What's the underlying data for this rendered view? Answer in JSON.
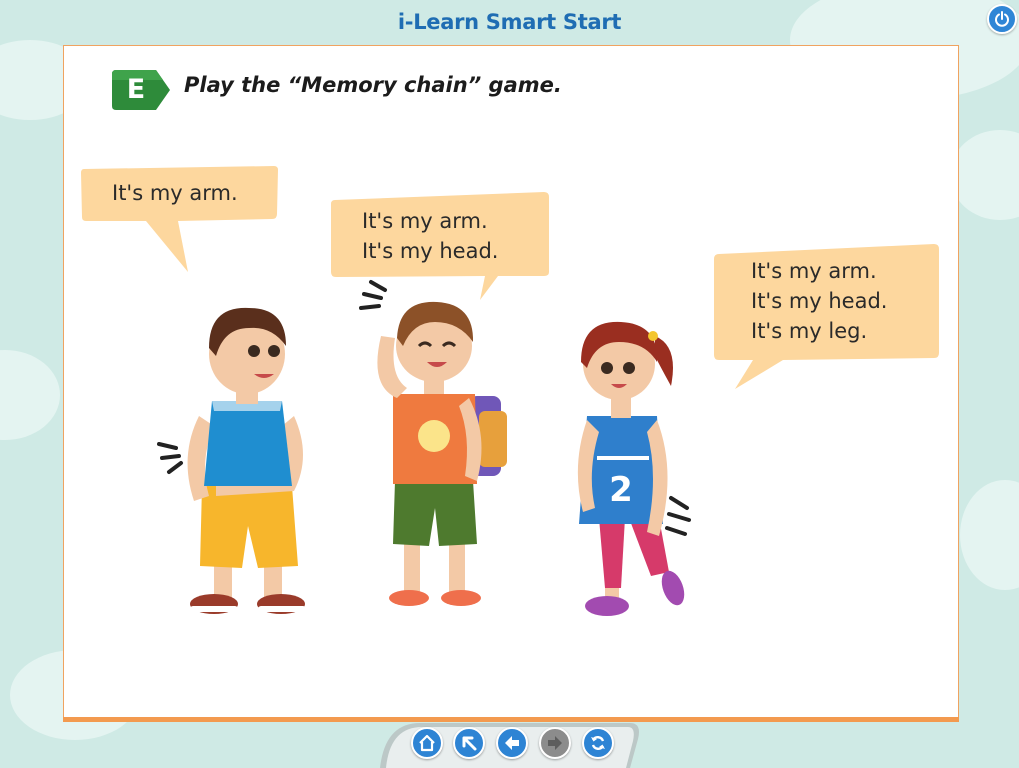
{
  "app": {
    "title": "i-Learn Smart Start"
  },
  "activity": {
    "badge": "E",
    "instruction": "Play the “Memory chain” game."
  },
  "bubbles": [
    {
      "lines": "It's my arm."
    },
    {
      "lines": "It's my arm.\nIt's my head."
    },
    {
      "lines": "It's my arm.\nIt's my head.\nIt's my leg."
    }
  ],
  "characters": [
    {
      "name": "boy-pointing-arm",
      "shirt_number": ""
    },
    {
      "name": "boy-pointing-head",
      "shirt_number": ""
    },
    {
      "name": "girl-pointing-leg",
      "shirt_number": "2"
    }
  ],
  "nav": {
    "buttons": [
      {
        "icon": "home-icon",
        "enabled": true
      },
      {
        "icon": "up-left-arrow-icon",
        "enabled": true
      },
      {
        "icon": "back-arrow-icon",
        "enabled": true
      },
      {
        "icon": "forward-arrow-icon",
        "enabled": false
      },
      {
        "icon": "refresh-icon",
        "enabled": true
      }
    ]
  },
  "colors": {
    "accent": "#1f6db3",
    "bubble": "#fdd79e",
    "badge": "#2e8b3a",
    "frame": "#f39a4f",
    "background": "#cfeae5"
  }
}
